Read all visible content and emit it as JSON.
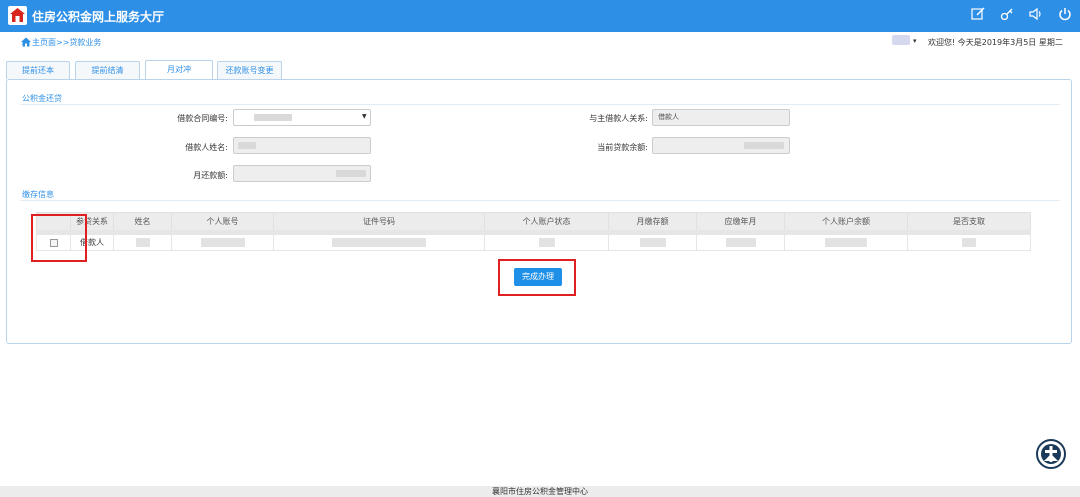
{
  "app": {
    "title": "住房公积金网上服务大厅"
  },
  "colors": {
    "primary": "#2d8fe6",
    "highlight": "#e02020"
  },
  "header_icons": [
    "edit-icon",
    "key-icon",
    "speaker-icon",
    "power-icon"
  ],
  "breadcrumb": "主页面>>贷款业务",
  "user": {
    "greeting": "欢迎您!  今天是2019年3月5日 星期二"
  },
  "tabs": [
    {
      "label": "提前还本",
      "active": false
    },
    {
      "label": "提前结清",
      "active": false
    },
    {
      "label": "月对冲",
      "active": true
    },
    {
      "label": "还款账号变更",
      "active": false
    }
  ],
  "section1": {
    "title": "公积金还贷",
    "contract_label": "借款合同编号:",
    "relation_label": "与主借款人关系:",
    "relation_value": "借款人",
    "borrower_label": "借款人姓名:",
    "balance_label": "当前贷款余额:",
    "monthly_label": "月还款额:"
  },
  "section2": {
    "title": "缴存信息",
    "columns": [
      "参贷关系",
      "姓名",
      "个人账号",
      "证件号码",
      "个人账户状态",
      "月缴存额",
      "应缴年月",
      "个人账户余额",
      "是否支取"
    ],
    "rows": [
      {
        "relation": "借款人"
      }
    ]
  },
  "complete_button": "完成办理",
  "footer": "襄阳市住房公积金管理中心"
}
